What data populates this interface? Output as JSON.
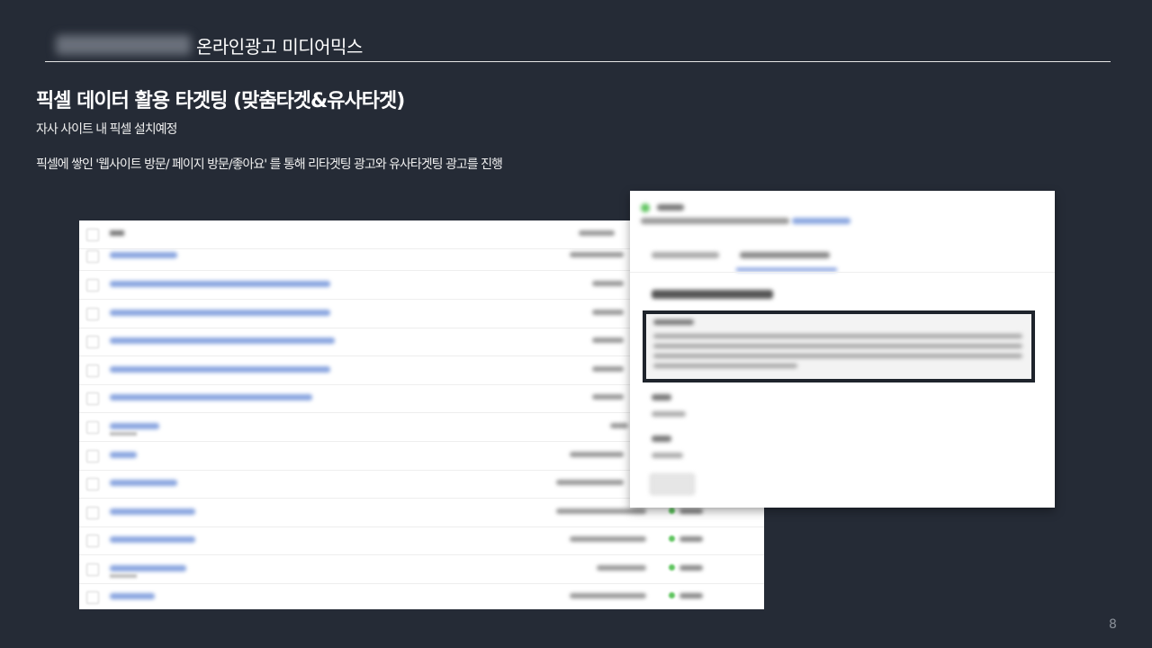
{
  "header": {
    "section_title": "온라인광고  미디어믹스"
  },
  "title": "픽셀 데이터 활용 타겟팅 (맞춤타겟&유사타겟)",
  "lines": {
    "line1": "자사 사이트 내 픽셀 설치예정",
    "line2": "픽셀에 쌓인 '웹사이트 방문/ 페이지 방문/좋아요' 를 통해 리타겟팅 광고와 유사타겟팅 광고를 진행"
  },
  "page_number": "8",
  "colors": {
    "background": "#252b36",
    "text": "#ffffff",
    "highlight_border": "#1f242c",
    "status_green": "#5fc45f"
  }
}
